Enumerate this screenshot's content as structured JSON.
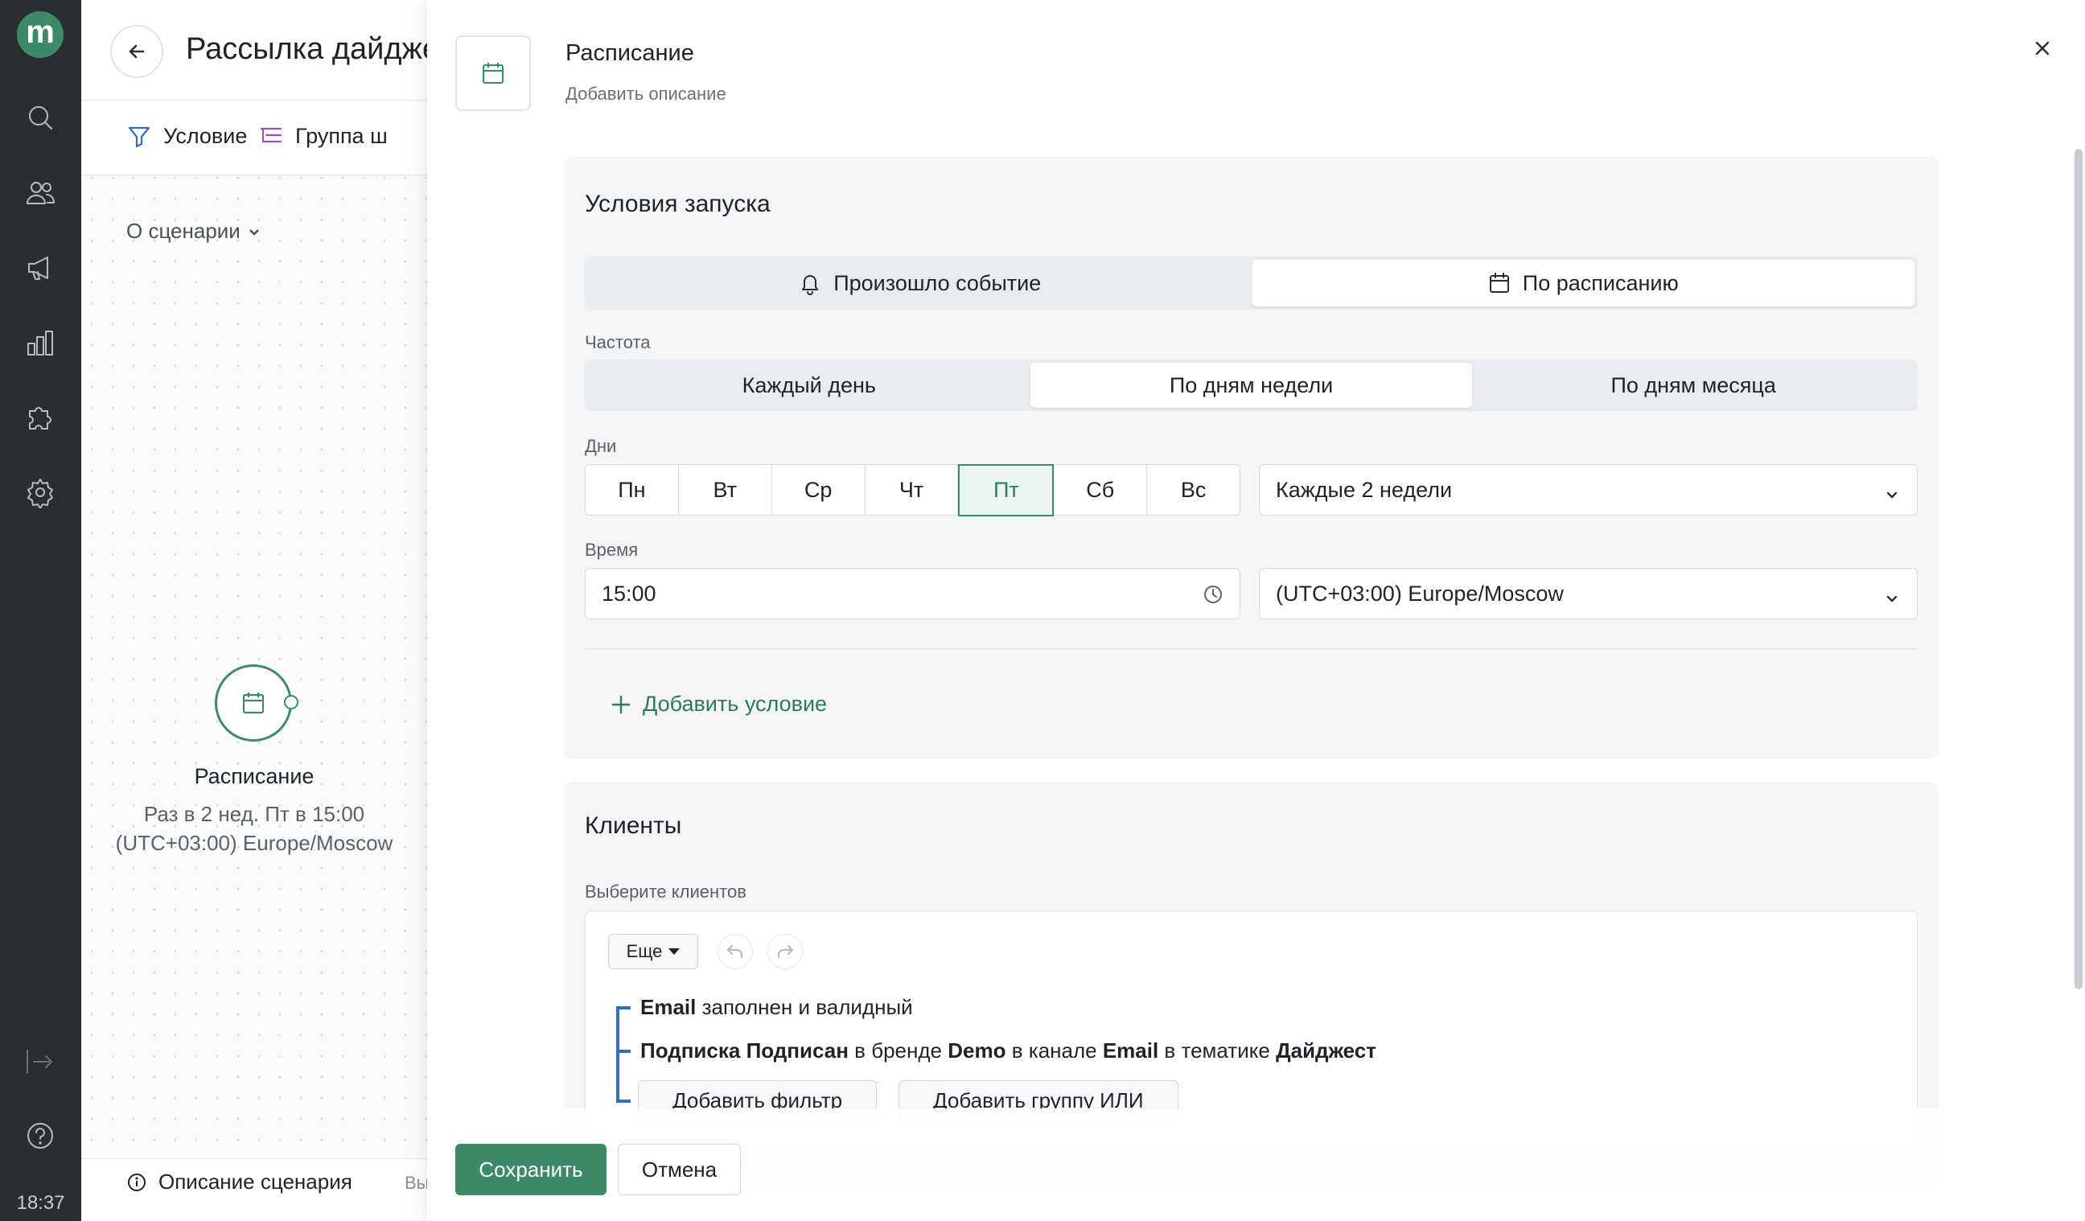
{
  "rail": {
    "logo_letter": "m",
    "icons": [
      "search-icon",
      "users-icon",
      "megaphone-icon",
      "analytics-icon",
      "puzzle-icon",
      "gear-icon",
      "collapse-icon",
      "help-icon"
    ],
    "clock": "18:37"
  },
  "canvas": {
    "title": "Рассылка дайдже",
    "toolbar": {
      "condition": "Условие",
      "group": "Группа ш"
    },
    "about": "О сценарии",
    "node": {
      "label": "Расписание",
      "line1": "Раз в 2 нед. Пт в 15:00",
      "line2": "(UTC+03:00) Europe/Moscow"
    },
    "footer": {
      "description": "Описание сценария",
      "extra": "Вы"
    }
  },
  "drawer": {
    "title": "Расписание",
    "subtitle": "Добавить описание",
    "launch": {
      "heading": "Условия запуска",
      "trigger_tabs": [
        {
          "label": "Произошло событие",
          "icon": "bell-icon",
          "active": false
        },
        {
          "label": "По расписанию",
          "icon": "calendar-icon",
          "active": true
        }
      ],
      "frequency_label": "Частота",
      "frequency_tabs": [
        {
          "label": "Каждый день",
          "active": false
        },
        {
          "label": "По дням недели",
          "active": true
        },
        {
          "label": "По дням месяца",
          "active": false
        }
      ],
      "days_label": "Дни",
      "days": [
        "Пн",
        "Вт",
        "Ср",
        "Чт",
        "Пт",
        "Сб",
        "Вс"
      ],
      "selected_day": "Пт",
      "period": "Каждые 2 недели",
      "time_label": "Время",
      "time": "15:00",
      "timezone": "(UTC+03:00) Europe/Moscow",
      "add_condition": "Добавить условие"
    },
    "clients": {
      "heading": "Клиенты",
      "select_label": "Выберите клиентов",
      "more": "Еще",
      "rule1": {
        "b1": "Email",
        "t1": " заполнен и валидный"
      },
      "rule2": {
        "b1": "Подписка Подписан",
        "t1": " в бренде ",
        "b2": "Demo",
        "t2": " в канале ",
        "b3": "Email",
        "t3": " в тематике ",
        "b4": "Дайджест"
      },
      "add_filter": "Добавить фильтр",
      "add_or_group": "Добавить группу ИЛИ"
    },
    "buttons": {
      "save": "Сохранить",
      "cancel": "Отмена"
    }
  },
  "colors": {
    "accent": "#3d8a68",
    "rail": "#2b2e31",
    "tree": "#2f6fbe"
  }
}
